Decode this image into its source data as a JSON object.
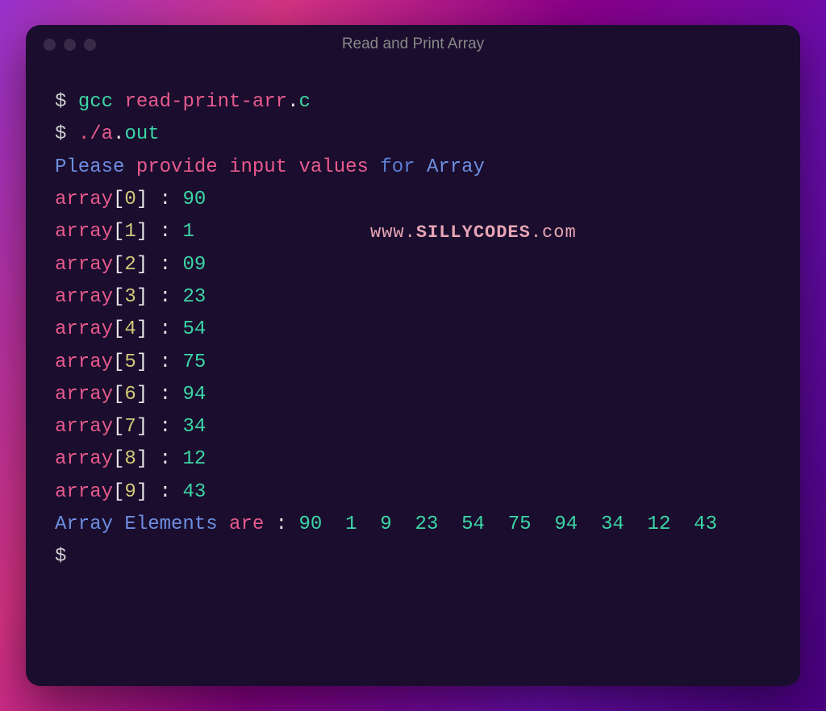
{
  "window": {
    "title": "Read and Print Array"
  },
  "commands": {
    "prompt": "$",
    "compile_cmd": "gcc",
    "compile_file_base": "read-print-arr",
    "compile_file_dot": ".",
    "compile_file_ext": "c",
    "run_prefix": "./",
    "run_base": "a",
    "run_dot": ".",
    "run_ext": "out"
  },
  "program": {
    "input_prompt_1": "Please",
    "input_prompt_2": "provide",
    "input_prompt_3": "input",
    "input_prompt_4": "values",
    "input_prompt_5": "for",
    "input_prompt_6": "Array",
    "array_label": "array",
    "colon": ":",
    "entries": [
      {
        "idx": "0",
        "val": "90"
      },
      {
        "idx": "1",
        "val": "1"
      },
      {
        "idx": "2",
        "val": "09"
      },
      {
        "idx": "3",
        "val": "23"
      },
      {
        "idx": "4",
        "val": "54"
      },
      {
        "idx": "5",
        "val": "75"
      },
      {
        "idx": "6",
        "val": "94"
      },
      {
        "idx": "7",
        "val": "34"
      },
      {
        "idx": "8",
        "val": "12"
      },
      {
        "idx": "9",
        "val": "43"
      }
    ],
    "output_label_1": "Array",
    "output_label_2": "Elements",
    "output_label_3": "are",
    "output_colon": ":",
    "output_values": "90  1  9  23  54  75  94  34  12  43"
  },
  "watermark": {
    "prefix": "www.",
    "brand": "SILLYCODES",
    "suffix": ".com"
  }
}
